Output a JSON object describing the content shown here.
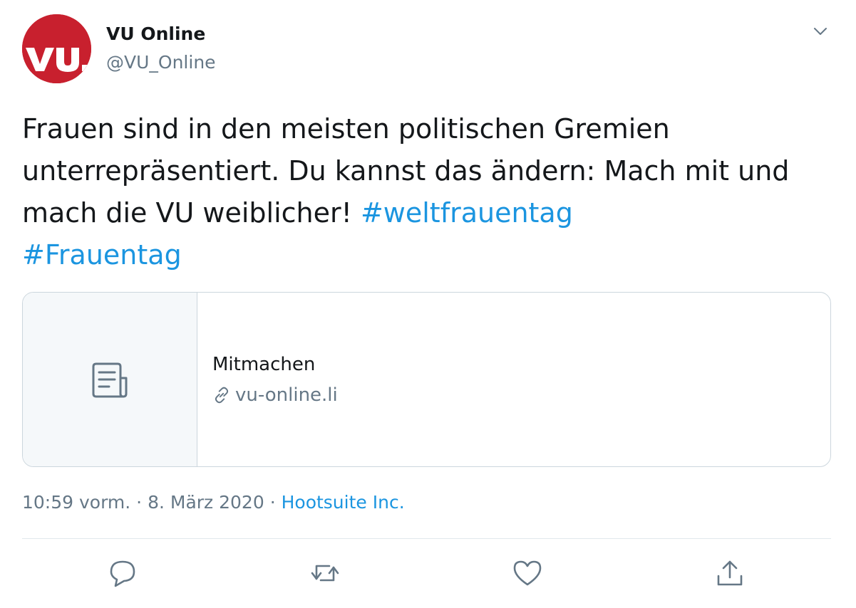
{
  "author": {
    "name": "VU Online",
    "handle": "@VU_Online",
    "avatar_text": "vu."
  },
  "tweet": {
    "text_plain": "Frauen sind in den meisten politischen Gremien unterrepräsentiert. Du kannst das ändern: Mach mit und mach die VU weiblicher! ",
    "hashtag_1": "#weltfrauentag",
    "hashtag_2": "#Frauentag"
  },
  "card": {
    "title": "Mitmachen",
    "domain": "vu-online.li"
  },
  "meta": {
    "time": "10:59 vorm.",
    "separator": " · ",
    "date": "8. März 2020",
    "source": "Hootsuite Inc."
  },
  "icons": {
    "menu": "chevron-down-icon",
    "card": "document-icon",
    "link": "link-icon",
    "reply": "reply-icon",
    "retweet": "retweet-icon",
    "like": "heart-icon",
    "share": "share-icon"
  },
  "colors": {
    "brand_red": "#c8202e",
    "link_blue": "#1b95e0",
    "secondary_text": "#657786",
    "border": "#ccd6dd"
  }
}
